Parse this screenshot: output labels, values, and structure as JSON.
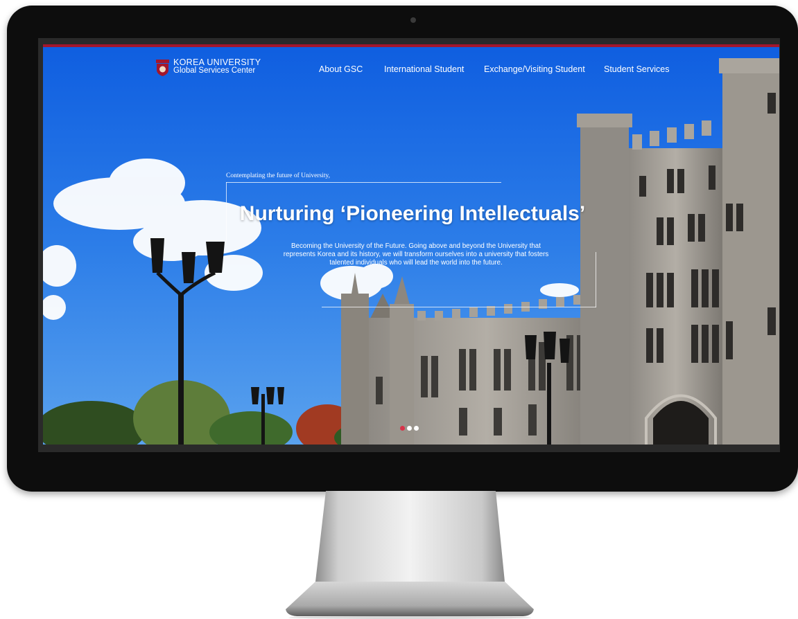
{
  "site": {
    "logo_line1": "KOREA UNIVERSITY",
    "logo_line2": "Global Services Center"
  },
  "nav": {
    "items": [
      {
        "label": "About GSC"
      },
      {
        "label": "International Student"
      },
      {
        "label": "Exchange/Visiting Student"
      },
      {
        "label": "Student Services"
      }
    ]
  },
  "hero": {
    "subtitle": "Contemplating the future of University,",
    "title": "Nurturing ‘Pioneering Intellectuals’",
    "description": "Becoming the University of the Future. Going above and beyond the University that represents Korea and its history, we will transform ourselves into a university that fosters talented individuals who will lead the world into the future."
  },
  "slider": {
    "slide_count": 3,
    "active_slide": 1
  },
  "colors": {
    "accent": "#a3162c",
    "sky": "#1f6fe0",
    "active_dot": "#d8334a"
  }
}
